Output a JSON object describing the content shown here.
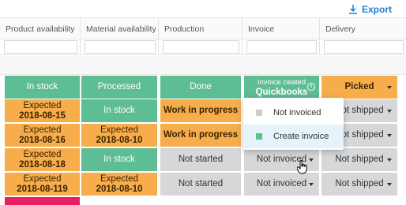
{
  "toolbar": {
    "export_label": "Export",
    "export_icon": "download-icon"
  },
  "columns": [
    "Product availability",
    "Material availability",
    "Production",
    "Invoice",
    "Delivery"
  ],
  "rows": [
    {
      "product": {
        "lines": [
          "In stock"
        ],
        "color": "green"
      },
      "material": {
        "lines": [
          "Processed"
        ],
        "color": "green"
      },
      "production": {
        "lines": [
          "Done"
        ],
        "color": "green"
      },
      "invoice": {
        "lines": [
          "Invoice ceated",
          "Quickbooks"
        ],
        "color": "green",
        "icon": "info-icon"
      },
      "delivery": {
        "lines": [
          "Picked"
        ],
        "color": "orange"
      }
    },
    {
      "product": {
        "lines": [
          "Expected",
          "2018-08-15"
        ],
        "color": "orange"
      },
      "material": {
        "lines": [
          "In stock"
        ],
        "color": "green"
      },
      "production": {
        "lines": [
          "Work in progress"
        ],
        "color": "orange"
      },
      "invoice": {
        "lines": [
          ""
        ],
        "color": "gray"
      },
      "delivery": {
        "lines": [
          "Not shipped"
        ],
        "color": "gray"
      }
    },
    {
      "product": {
        "lines": [
          "Expected",
          "2018-08-16"
        ],
        "color": "orange"
      },
      "material": {
        "lines": [
          "Expected",
          "2018-08-10"
        ],
        "color": "orange"
      },
      "production": {
        "lines": [
          "Work in progress"
        ],
        "color": "orange"
      },
      "invoice": {
        "lines": [
          ""
        ],
        "color": "gray"
      },
      "delivery": {
        "lines": [
          "Not shipped"
        ],
        "color": "gray"
      }
    },
    {
      "product": {
        "lines": [
          "Expected",
          "2018-08-18"
        ],
        "color": "orange"
      },
      "material": {
        "lines": [
          "In stock"
        ],
        "color": "green"
      },
      "production": {
        "lines": [
          "Not started"
        ],
        "color": "gray"
      },
      "invoice": {
        "lines": [
          "Not invoiced"
        ],
        "color": "gray"
      },
      "delivery": {
        "lines": [
          "Not shipped"
        ],
        "color": "gray"
      }
    },
    {
      "product": {
        "lines": [
          "Expected",
          "2018-08-119"
        ],
        "color": "orange"
      },
      "material": {
        "lines": [
          "Expected",
          "2018-08-10"
        ],
        "color": "orange"
      },
      "production": {
        "lines": [
          "Not started"
        ],
        "color": "gray"
      },
      "invoice": {
        "lines": [
          "Not invoiced"
        ],
        "color": "gray"
      },
      "delivery": {
        "lines": [
          "Not shipped"
        ],
        "color": "gray"
      }
    }
  ],
  "dropdown": {
    "options": [
      {
        "label": "Not invoiced",
        "swatch": "#cccccc",
        "selected": false
      },
      {
        "label": "Create invoice",
        "swatch": "#5dbd93",
        "selected": true
      }
    ]
  },
  "colors": {
    "green": "#5dbd93",
    "orange": "#f7ad4b",
    "gray": "#d5d7d9",
    "pink": "#e71f63",
    "accent": "#1c7fd1"
  }
}
